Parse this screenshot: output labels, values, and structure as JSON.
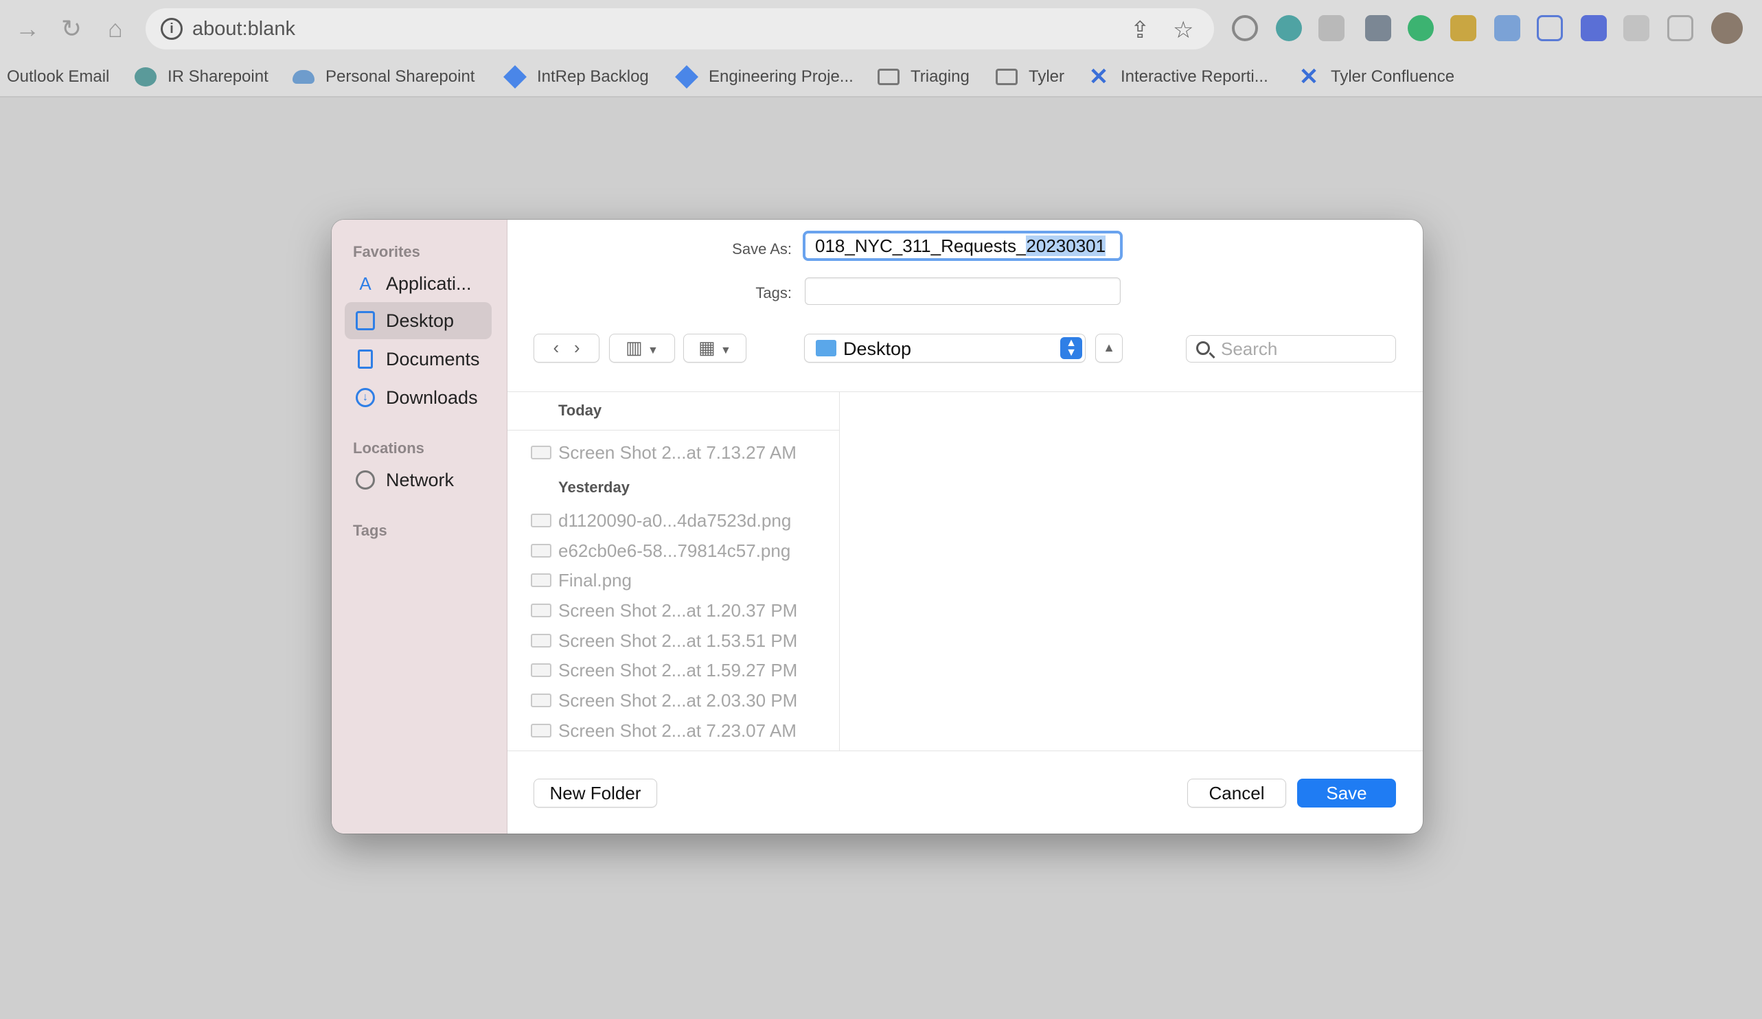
{
  "browser": {
    "address": "about:blank",
    "bookmarks": [
      {
        "label": "Outlook Email",
        "icon": "none"
      },
      {
        "label": "IR Sharepoint",
        "icon": "sharepoint-icon"
      },
      {
        "label": "Personal Sharepoint",
        "icon": "cloud-icon"
      },
      {
        "label": "IntRep Backlog",
        "icon": "diamond-icon"
      },
      {
        "label": "Engineering Proje...",
        "icon": "diamond-icon"
      },
      {
        "label": "Triaging",
        "icon": "folder-icon"
      },
      {
        "label": "Tyler",
        "icon": "folder-icon"
      },
      {
        "label": "Interactive Reporti...",
        "icon": "confluence-icon"
      },
      {
        "label": "Tyler Confluence",
        "icon": "confluence-icon"
      }
    ]
  },
  "dialog": {
    "sidebar": {
      "favorites_heading": "Favorites",
      "favorites": [
        {
          "label": "Applicati...",
          "icon": "applications-icon",
          "selected": false
        },
        {
          "label": "Desktop",
          "icon": "desktop-icon",
          "selected": true
        },
        {
          "label": "Documents",
          "icon": "document-icon",
          "selected": false
        },
        {
          "label": "Downloads",
          "icon": "download-icon",
          "selected": false
        }
      ],
      "locations_heading": "Locations",
      "locations": [
        {
          "label": "Network",
          "icon": "globe-icon"
        }
      ],
      "tags_heading": "Tags"
    },
    "save_as_label": "Save As:",
    "save_as_value_prefix": "018_NYC_311_Requests_",
    "save_as_value_selected": "20230301",
    "tags_label": "Tags:",
    "location": "Desktop",
    "search_placeholder": "Search",
    "groups": [
      {
        "heading": "Today",
        "files": [
          "Screen Shot 2...at 7.13.27 AM"
        ]
      },
      {
        "heading": "Yesterday",
        "files": [
          "d1120090-a0...4da7523d.png",
          "e62cb0e6-58...79814c57.png",
          "Final.png",
          "Screen Shot 2...at 1.20.37 PM",
          "Screen Shot 2...at 1.53.51 PM",
          "Screen Shot 2...at 1.59.27 PM",
          "Screen Shot 2...at 2.03.30 PM",
          "Screen Shot 2...at 7.23.07 AM"
        ]
      }
    ],
    "new_folder_label": "New Folder",
    "cancel_label": "Cancel",
    "save_label": "Save",
    "accent_color": "#1f7cf3"
  }
}
